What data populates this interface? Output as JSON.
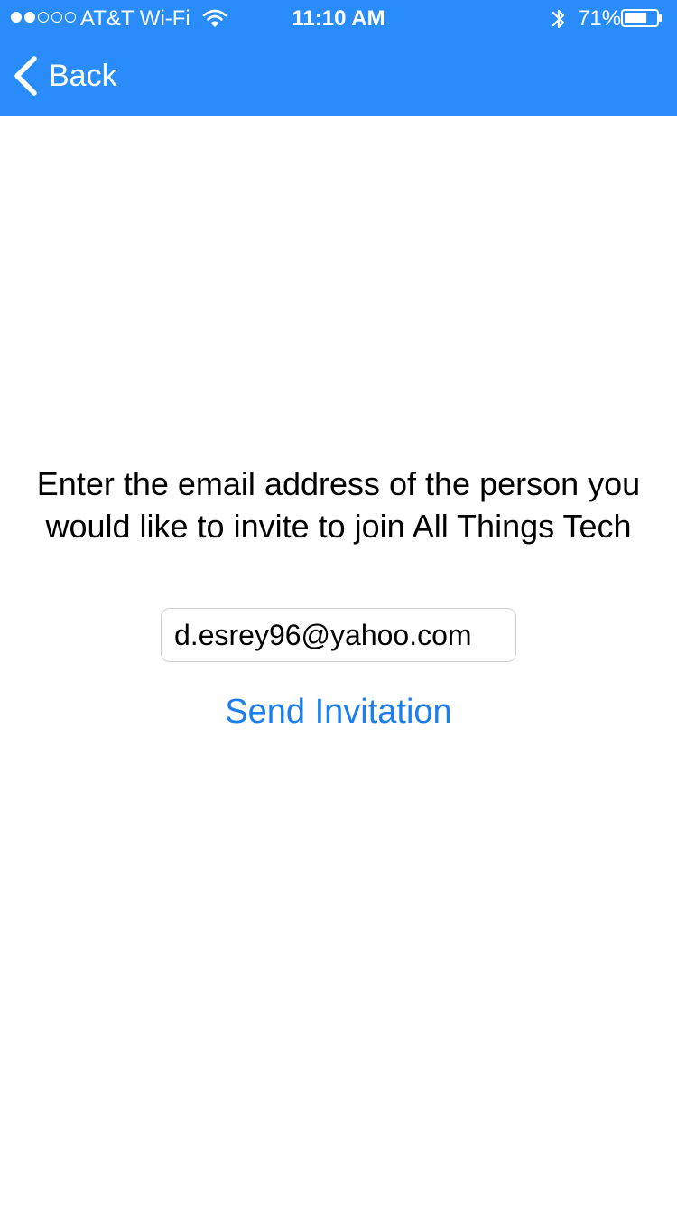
{
  "status_bar": {
    "carrier": "AT&T Wi-Fi",
    "signal_bars_filled": 2,
    "signal_bars_total": 5,
    "time": "11:10 AM",
    "battery_percent": "71%",
    "battery_level": 0.71,
    "icons": [
      "wifi-icon",
      "bluetooth-icon",
      "battery-icon"
    ]
  },
  "nav": {
    "back_label": "Back",
    "back_icon": "chevron-left-icon"
  },
  "invite": {
    "prompt": "Enter the email address of the person you would like to invite to join All Things Tech",
    "email_value": "d.esrey96@yahoo.com",
    "send_label": "Send Invitation"
  },
  "colors": {
    "nav_background": "#2a8cf9",
    "link": "#1b7ff0"
  }
}
